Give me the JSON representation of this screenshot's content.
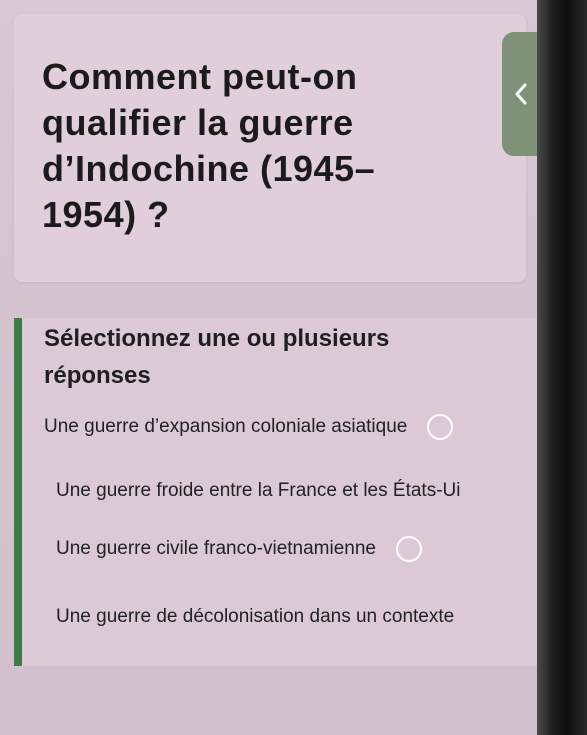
{
  "question": {
    "line1": "Comment peut-on",
    "line2": "qualifier la guerre",
    "line3": "d’Indochine (1945–",
    "line4": "1954) ?"
  },
  "nav": {
    "back_icon": "chevron-left-icon"
  },
  "answers": {
    "instruction_line1": "Sélectionnez une ou plusieurs",
    "instruction_line2": "réponses",
    "options": [
      {
        "label": "Une guerre d’expansion coloniale asiatique",
        "selected": false
      },
      {
        "label": "Une guerre froide entre la France et les États-Ui",
        "selected": false
      },
      {
        "label": "Une guerre civile franco-vietnamienne",
        "selected": false
      },
      {
        "label": "Une guerre de décolonisation dans un contexte",
        "selected": false
      }
    ]
  },
  "colors": {
    "accent_bar": "#3e7d46",
    "back_tab": "#7d9276",
    "background": "#d8c8d2"
  }
}
